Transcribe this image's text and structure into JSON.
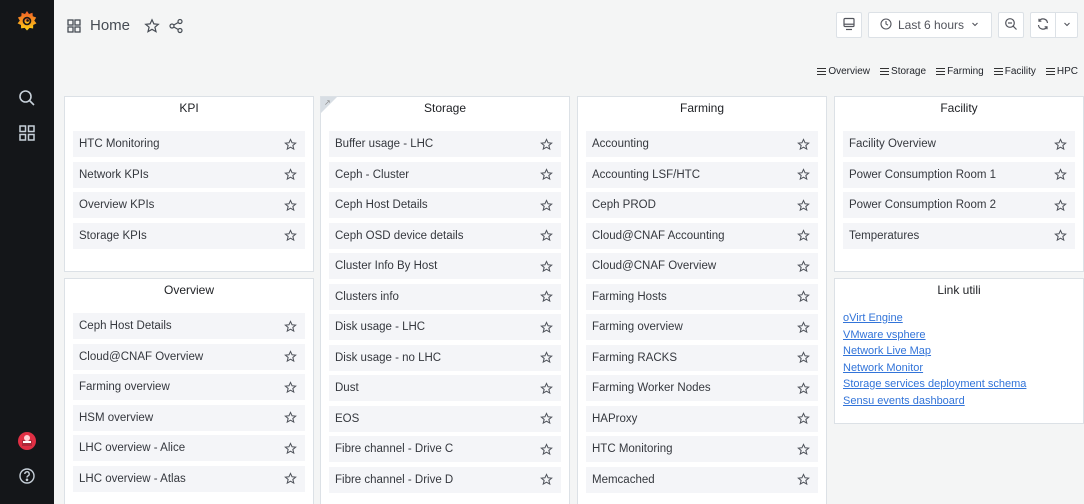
{
  "header": {
    "title": "Home",
    "time_range": "Last 6 hours"
  },
  "linkbar": [
    "Overview",
    "Storage",
    "Farming",
    "Facility",
    "HPC"
  ],
  "panels": {
    "kpi": {
      "title": "KPI",
      "items": [
        "HTC Monitoring",
        "Network KPIs",
        "Overview KPIs",
        "Storage KPIs"
      ]
    },
    "overview": {
      "title": "Overview",
      "items": [
        "Ceph Host Details",
        "Cloud@CNAF Overview",
        "Farming overview",
        "HSM overview",
        "LHC overview - Alice",
        "LHC overview - Atlas"
      ]
    },
    "storage": {
      "title": "Storage",
      "items": [
        "Buffer usage - LHC",
        "Ceph - Cluster",
        "Ceph Host Details",
        "Ceph OSD device details",
        "Cluster Info By Host",
        "Clusters info",
        "Disk usage - LHC",
        "Disk usage - no LHC",
        "Dust",
        "EOS",
        "Fibre channel - Drive C",
        "Fibre channel - Drive D"
      ]
    },
    "farming": {
      "title": "Farming",
      "items": [
        "Accounting",
        "Accounting LSF/HTC",
        "Ceph PROD",
        "Cloud@CNAF Accounting",
        "Cloud@CNAF Overview",
        "Farming Hosts",
        "Farming overview",
        "Farming RACKS",
        "Farming Worker Nodes",
        "HAProxy",
        "HTC Monitoring",
        "Memcached"
      ]
    },
    "facility": {
      "title": "Facility",
      "items": [
        "Facility Overview",
        "Power Consumption Room 1",
        "Power Consumption Room 2",
        "Temperatures"
      ]
    },
    "links": {
      "title": "Link utili",
      "items": [
        "oVirt Engine",
        "VMware vsphere",
        "Network Live Map",
        "Network Monitor",
        "Storage services deployment schema",
        "Sensu events dashboard"
      ]
    }
  },
  "colors": {
    "sidebar_bg": "#141619",
    "link": "#3274d9",
    "logo": "#f46800"
  }
}
